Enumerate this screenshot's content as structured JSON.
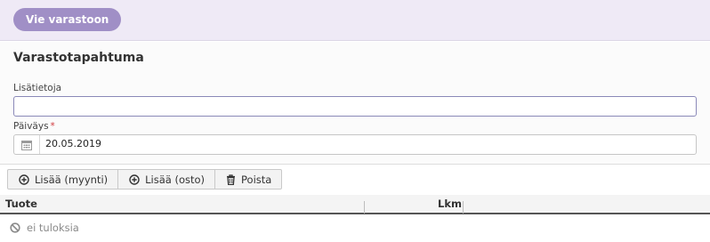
{
  "header": {
    "export_button_label": "Vie varastoon"
  },
  "form": {
    "title": "Varastotapahtuma",
    "notes": {
      "label": "Lisätietoja",
      "value": ""
    },
    "date": {
      "label": "Päiväys",
      "required_mark": "*",
      "value": "20.05.2019"
    }
  },
  "toolbar": {
    "add_sale_label": "Lisää (myynti)",
    "add_purchase_label": "Lisää (osto)",
    "delete_label": "Poista"
  },
  "table": {
    "columns": [
      "Tuote",
      "Lkm"
    ],
    "empty_text": "ei tuloksia"
  },
  "colors": {
    "accent": "#a08fc6",
    "topbar": "#efeaf6",
    "required": "#d0393e"
  },
  "icons": {
    "date": "calendar-icon",
    "add": "plus-circle-icon",
    "delete": "trash-icon",
    "empty": "no-entry-icon"
  }
}
